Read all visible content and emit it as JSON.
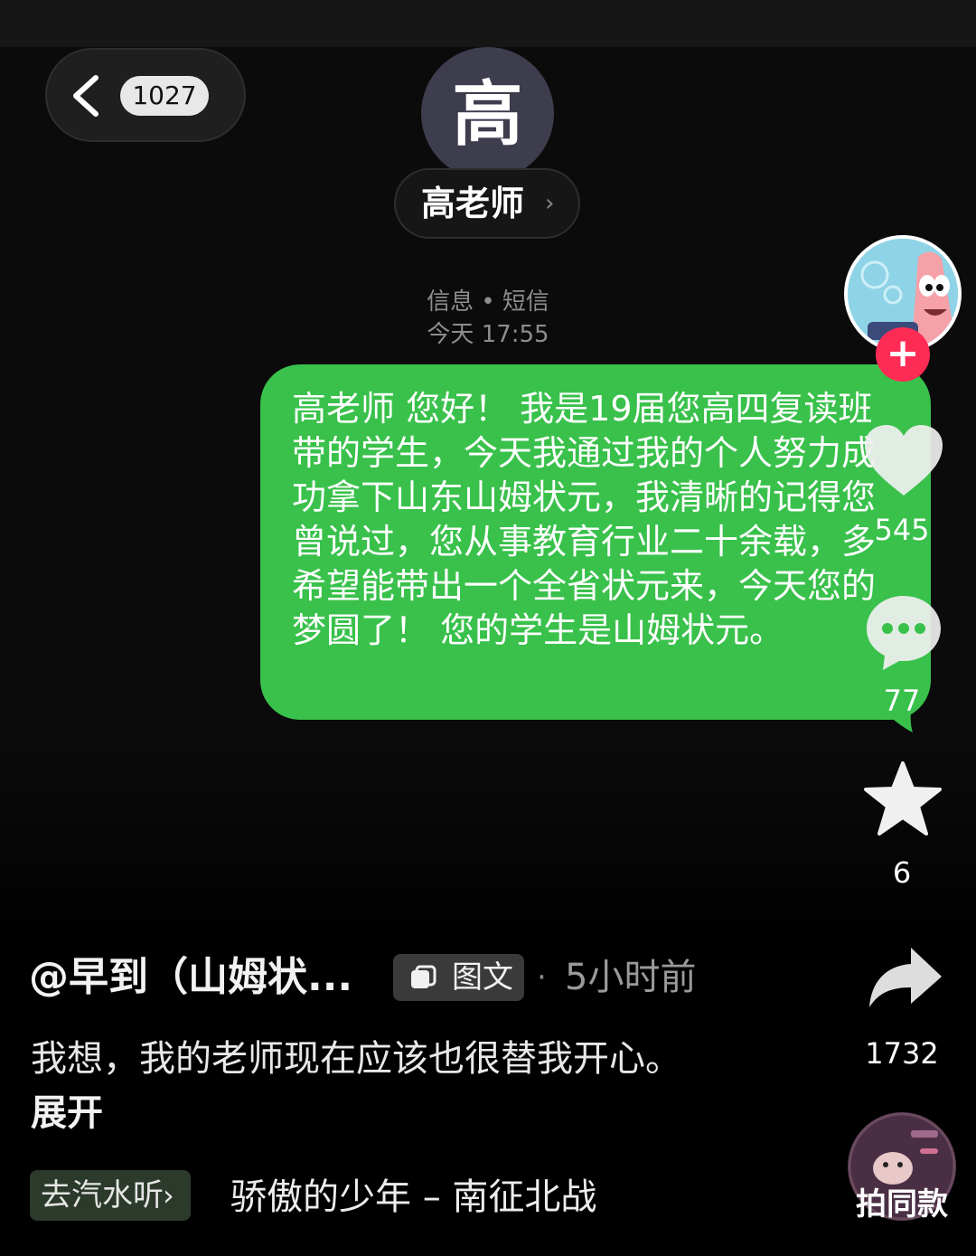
{
  "header": {
    "unread_count": "1027",
    "contact_initial": "高",
    "contact_name": "高老师",
    "message_meta": "信息 • 短信",
    "message_time": "今天 17:55"
  },
  "message": {
    "text": "高老师 您好！ 我是19届您高四复读班带的学生，今天我通过我的个人努力成功拿下山东山姆状元，我清晰的记得您曾说过，您从事教育行业二十余载，多希望能带出一个全省状元来，今天您的梦圆了！ 您的学生是山姆状元。",
    "bubble_color": "#39c14b"
  },
  "rail": {
    "likes": "545",
    "comments": "77",
    "favorites": "6",
    "shares": "1732",
    "same_style_label": "拍同款",
    "accent": "#fe2c55"
  },
  "post": {
    "author": "@早到（山姆状...",
    "type_tag": "图文",
    "separator": "·",
    "time_ago": "5小时前",
    "caption": "我想，我的老师现在应该也很替我开心。",
    "expand_label": "展开"
  },
  "music": {
    "listen_label": "去汽水听",
    "song": "骄傲的少年 – 南征北战"
  }
}
